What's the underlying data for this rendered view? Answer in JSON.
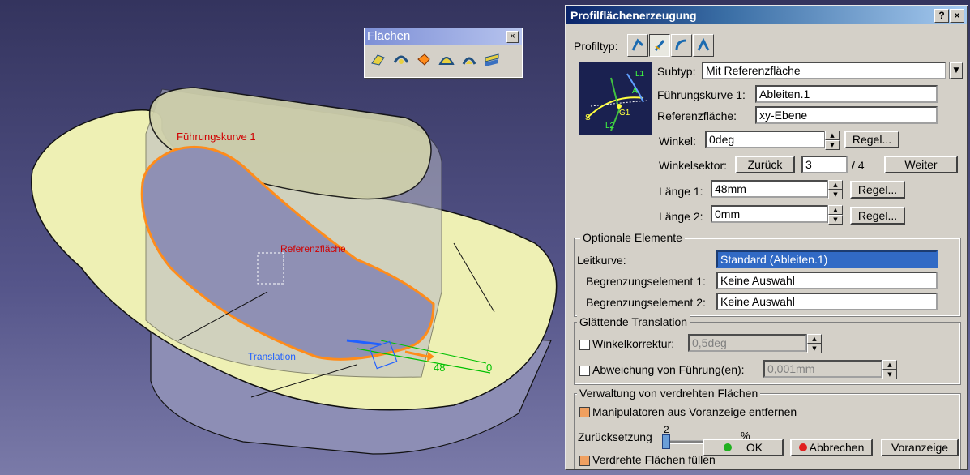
{
  "viewport": {
    "label_guide": "Führungskurve 1",
    "label_ref": "Referenzfläche",
    "label_translation": "Translation",
    "dim_48": "48",
    "dim_0": "0"
  },
  "toolbar": {
    "title": "Flächen",
    "close": "×",
    "icons": [
      "extrude-icon",
      "revolve-icon",
      "sweep-icon",
      "fill-icon",
      "loft-icon",
      "blend-icon"
    ]
  },
  "dialog": {
    "title": "Profilflächenerzeugung",
    "help": "?",
    "close": "×",
    "profiltyp_label": "Profiltyp:",
    "subtyp_label": "Subtyp:",
    "subtyp_value": "Mit Referenzfläche",
    "guide_label": "Führungskurve 1:",
    "guide_value": "Ableiten.1",
    "ref_label": "Referenzfläche:",
    "ref_value": "xy-Ebene",
    "winkel_label": "Winkel:",
    "winkel_value": "0deg",
    "regel": "Regel...",
    "sektor_label": "Winkelsektor:",
    "zurueck": "Zurück",
    "sektor_value": "3",
    "sektor_total": "/ 4",
    "weiter": "Weiter",
    "laenge1_label": "Länge 1:",
    "laenge1_value": "48mm",
    "laenge2_label": "Länge 2:",
    "laenge2_value": "0mm",
    "opt_title": "Optionale Elemente",
    "leitkurve_label": "Leitkurve:",
    "leitkurve_value": "Standard (Ableiten.1)",
    "begr1_label": "Begrenzungselement 1:",
    "begr1_value": "Keine Auswahl",
    "begr2_label": "Begrenzungselement 2:",
    "begr2_value": "Keine Auswahl",
    "smooth_title": "Glättende Translation",
    "winkelkorr_label": "Winkelkorrektur:",
    "winkelkorr_value": "0,5deg",
    "abweichung_label": "Abweichung von Führung(en):",
    "abweichung_value": "0,001mm",
    "verdreht_title": "Verwaltung von verdrehten Flächen",
    "manip_label": "Manipulatoren aus Voranzeige entfernen",
    "zurueck_label": "Zurücksetzung",
    "slider_value": "2",
    "slider_unit": "%",
    "ok": "OK",
    "abbrechen": "Abbrechen",
    "voranzeige": "Voranzeige",
    "fill_label": "Verdrehte Flächen füllen",
    "preview": {
      "L1": "L1",
      "A": "A",
      "G1": "G1",
      "S": "S",
      "L2": "L2"
    }
  }
}
